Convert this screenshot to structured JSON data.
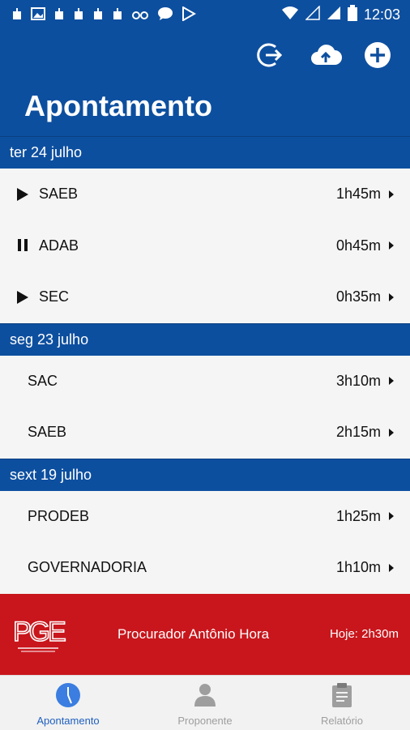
{
  "status_bar": {
    "time": "12:03"
  },
  "app_bar": {
    "title": "Apontamento",
    "actions": [
      "logout-icon",
      "cloud-upload-icon",
      "add-circle-icon"
    ]
  },
  "days": [
    {
      "label": "ter 24 julho",
      "items": [
        {
          "name": "SAEB",
          "duration": "1h45m",
          "control": "play"
        },
        {
          "name": "ADAB",
          "duration": "0h45m",
          "control": "pause"
        },
        {
          "name": "SEC",
          "duration": "0h35m",
          "control": "play"
        }
      ]
    },
    {
      "label": "seg 23 julho",
      "items": [
        {
          "name": "SAC",
          "duration": "3h10m"
        },
        {
          "name": "SAEB",
          "duration": "2h15m"
        }
      ]
    },
    {
      "label": "sext 19 julho",
      "items": [
        {
          "name": "PRODEB",
          "duration": "1h25m"
        },
        {
          "name": "GOVERNADORIA",
          "duration": "1h10m"
        }
      ]
    }
  ],
  "footer": {
    "logo_text": "PGE",
    "user": "Procurador Antônio Hora",
    "today": "Hoje: 2h30m",
    "colors": {
      "brand_red": "#c8161c",
      "primary_blue": "#0d4f9f"
    }
  },
  "bottom_nav": [
    {
      "label": "Apontamento",
      "icon": "clock-icon",
      "active": true
    },
    {
      "label": "Proponente",
      "icon": "person-icon",
      "active": false
    },
    {
      "label": "Relatório",
      "icon": "clipboard-icon",
      "active": false
    }
  ]
}
